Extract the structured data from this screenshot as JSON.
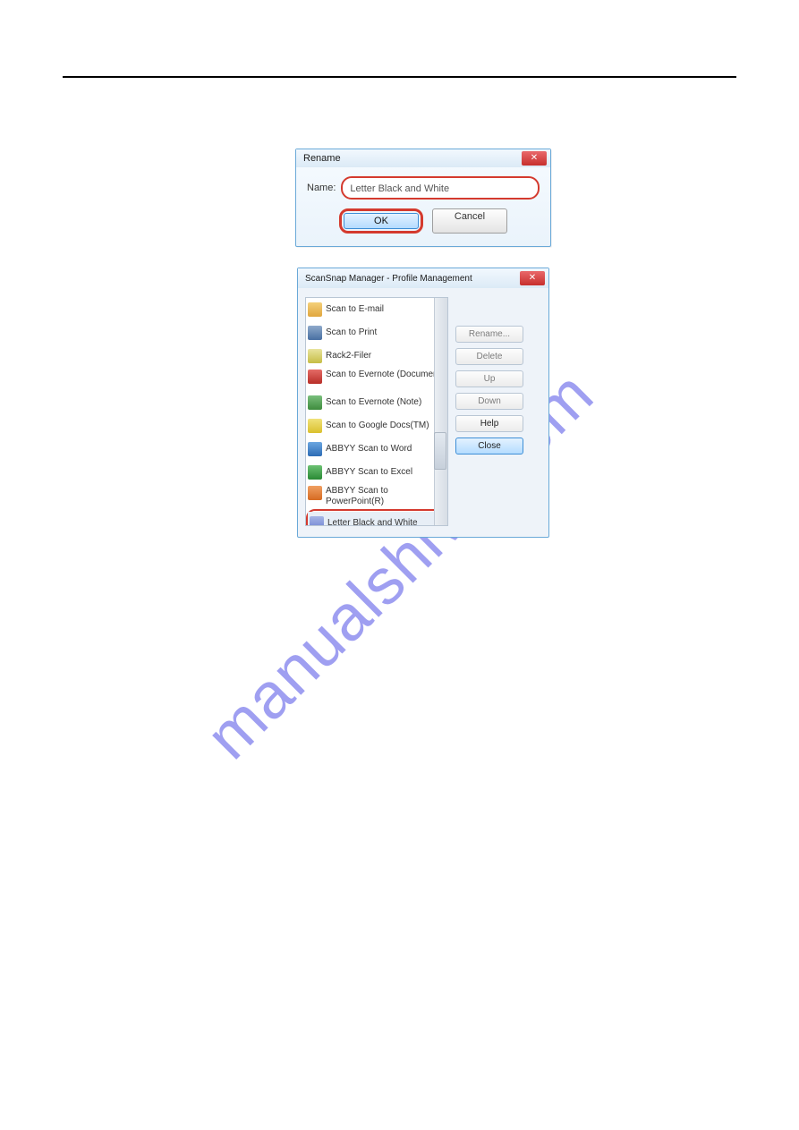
{
  "watermark_text": "manualshive.com",
  "rename_dialog": {
    "title": "Rename",
    "name_label": "Name:",
    "name_value": "Letter Black and White",
    "ok_label": "OK",
    "cancel_label": "Cancel"
  },
  "pm_dialog": {
    "title": "ScanSnap Manager - Profile Management",
    "items": [
      {
        "label": "Scan to E-mail",
        "icon": "email"
      },
      {
        "label": "Scan to Print",
        "icon": "print"
      },
      {
        "label": "Rack2-Filer",
        "icon": "folder"
      },
      {
        "label": "Scan to Evernote (Document)",
        "icon": "pdf"
      },
      {
        "label": "Scan to Evernote (Note)",
        "icon": "note"
      },
      {
        "label": "Scan to Google Docs(TM)",
        "icon": "gdocs"
      },
      {
        "label": "ABBYY Scan to Word",
        "icon": "word"
      },
      {
        "label": "ABBYY Scan to Excel",
        "icon": "excel"
      },
      {
        "label": "ABBYY Scan to PowerPoint(R)",
        "icon": "ppt"
      },
      {
        "label": "Letter Black and White",
        "icon": "snap",
        "highlight": true
      }
    ],
    "buttons": {
      "rename": "Rename...",
      "delete": "Delete",
      "up": "Up",
      "down": "Down",
      "help": "Help",
      "close": "Close"
    }
  }
}
